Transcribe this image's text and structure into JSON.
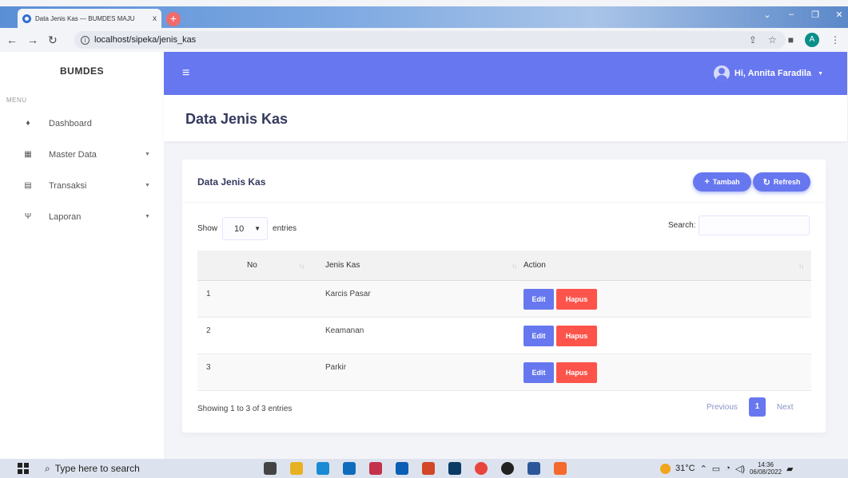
{
  "browser": {
    "tab_title": "Data Jenis Kas — BUMDES MAJU",
    "tab_close": "x",
    "new_tab": "+",
    "url": "localhost/sipeka/jenis_kas",
    "profile_initial": "A"
  },
  "sidebar": {
    "brand": "BUMDES",
    "menu_caption": "MENU",
    "items": [
      {
        "label": "Dashboard",
        "icon": "fire-icon"
      },
      {
        "label": "Master Data",
        "icon": "grid-icon"
      },
      {
        "label": "Transaksi",
        "icon": "file-icon"
      },
      {
        "label": "Laporan",
        "icon": "plug-icon"
      }
    ]
  },
  "header": {
    "user_greeting": "Hi, Annita Faradila",
    "accent_color": "#6777ef"
  },
  "page": {
    "title": "Data Jenis Kas",
    "card_title": "Data Jenis Kas",
    "add_button": "Tambah",
    "refresh_button": "Refresh",
    "show_label": "Show",
    "entries_value": "10",
    "entries_label": "entries",
    "search_label": "Search:",
    "search_value": ""
  },
  "table": {
    "columns": [
      "No",
      "Jenis Kas",
      "Action"
    ],
    "rows": [
      {
        "no": "1",
        "jenis": "Karcis Pasar"
      },
      {
        "no": "2",
        "jenis": "Keamanan"
      },
      {
        "no": "3",
        "jenis": "Parkir"
      }
    ],
    "edit_label": "Edit",
    "delete_label": "Hapus"
  },
  "footer": {
    "info": "Showing 1 to 3 of 3 entries",
    "previous": "Previous",
    "page_number": "1",
    "next": "Next"
  },
  "taskbar": {
    "search_placeholder": "Type here to search",
    "temperature": "31°C",
    "time": "14:36",
    "date": "06/08/2022"
  }
}
